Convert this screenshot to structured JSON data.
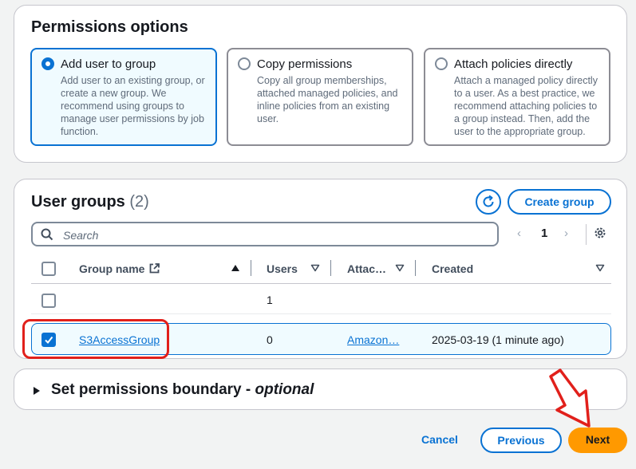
{
  "permissions": {
    "title": "Permissions options",
    "options": [
      {
        "label": "Add user to group",
        "description": "Add user to an existing group, or create a new group. We recommend using groups to manage user permissions by job function.",
        "selected": true
      },
      {
        "label": "Copy permissions",
        "description": "Copy all group memberships, attached managed policies, and inline policies from an existing user.",
        "selected": false
      },
      {
        "label": "Attach policies directly",
        "description": "Attach a managed policy directly to a user. As a best practice, we recommend attaching policies to a group instead. Then, add the user to the appropriate group.",
        "selected": false
      }
    ]
  },
  "groups": {
    "title": "User groups",
    "count": "(2)",
    "create_label": "Create group",
    "search_placeholder": "Search",
    "pagination": {
      "prev": "‹",
      "page": "1",
      "next": "›"
    },
    "columns": [
      "Group name",
      "Users",
      "Attac…",
      "Created"
    ],
    "rows": [
      {
        "name": "",
        "users": "1",
        "attached": "",
        "created": "",
        "checked": false
      },
      {
        "name": "S3AccessGroup",
        "users": "0",
        "attached": "Amazon…",
        "created": "2025-03-19 (1 minute ago)",
        "checked": true
      }
    ]
  },
  "boundary": {
    "title": "Set permissions boundary - ",
    "optional": "optional"
  },
  "footer": {
    "cancel": "Cancel",
    "previous": "Previous",
    "next": "Next"
  },
  "colors": {
    "accent": "#0972d3",
    "primary_button": "#ff9900",
    "annotation": "#e1201b"
  }
}
